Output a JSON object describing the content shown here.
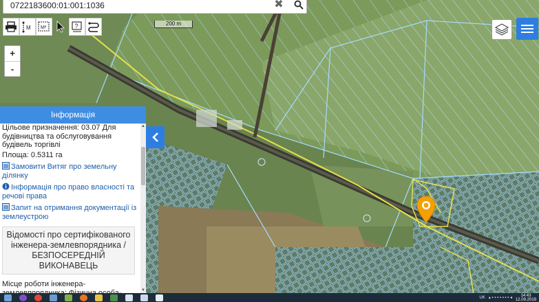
{
  "search": {
    "value": "0722183600:01:001:1036",
    "placeholder": ""
  },
  "map": {
    "scale_label": "200 m",
    "zoom_in": "+",
    "zoom_out": "-",
    "toolbar_icons": [
      "print-icon",
      "measure-distance-icon",
      "measure-area-icon",
      "pointer-icon",
      "identify-icon",
      "route-icon"
    ],
    "toolbar_glyphs": {
      "measure_distance": "M",
      "measure_area": "M²",
      "identify": "?"
    }
  },
  "panel": {
    "title": "Інформація",
    "purpose_text": "Цільове призначення: 03.07 Для будівництва та обслуговування будівель торгівлі",
    "area_text": "Площа: 0.5311 га",
    "links": [
      {
        "label": "Замовити Витяг про земельну ділянку",
        "icon": "document-icon"
      },
      {
        "label": "Інформація про право власності та речові права",
        "icon": "info-icon"
      },
      {
        "label": "Запит на отримання документації із землеустрою",
        "icon": "document-icon"
      }
    ],
    "section_title": "Відомості про сертифікованого інженера-землевпорядника / БЕЗПОСЕРЕДНІЙ ВИКОНАВЕЦЬ",
    "workplace_text": "Місце роботи інженера-землевпорядника: Фізична особа-підприємець Тимощук Богдан Павлович"
  },
  "taskbar": {
    "language": "UK",
    "time": "14:43",
    "date": "12.09.2019"
  },
  "colors": {
    "accent": "#3f8de3",
    "parcel_line": "#9fd8ff",
    "road_line": "#e6e04a",
    "marker": "#f5a000"
  }
}
